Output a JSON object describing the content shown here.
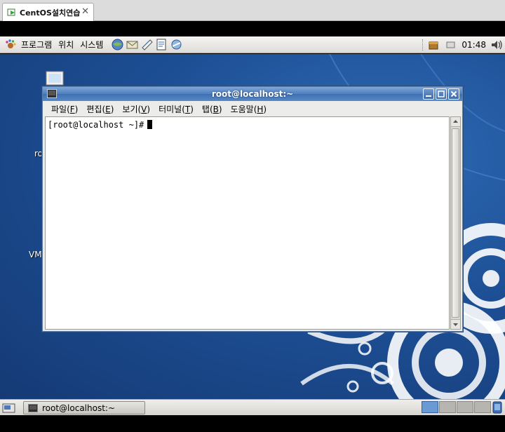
{
  "vm_tab": {
    "label": "CentOS설치연습",
    "close": "✕"
  },
  "top_panel": {
    "menus": [
      "프로그램",
      "위치",
      "시스템"
    ],
    "launchers": [
      "web-browser-icon",
      "email-icon",
      "notes-icon",
      "text-editor-icon",
      "network-icon"
    ],
    "clock": "01:48"
  },
  "desktop": {
    "labels": [
      "ro",
      "VM"
    ]
  },
  "terminal": {
    "title": "root@localhost:~",
    "menus": [
      {
        "label": "파일(",
        "key": "F",
        "end": ")"
      },
      {
        "label": "편집(",
        "key": "E",
        "end": ")"
      },
      {
        "label": "보기(",
        "key": "V",
        "end": ")"
      },
      {
        "label": "터미널(",
        "key": "T",
        "end": ")"
      },
      {
        "label": "탭(",
        "key": "B",
        "end": ")"
      },
      {
        "label": "도움말(",
        "key": "H",
        "end": ")"
      }
    ],
    "prompt": "[root@localhost ~]#"
  },
  "bottom_panel": {
    "task_label": "root@localhost:~",
    "workspaces": 4,
    "active_workspace": 1
  },
  "colors": {
    "desktop_blue": "#1d4f95",
    "titlebar_blue": "#4f7fbf"
  }
}
